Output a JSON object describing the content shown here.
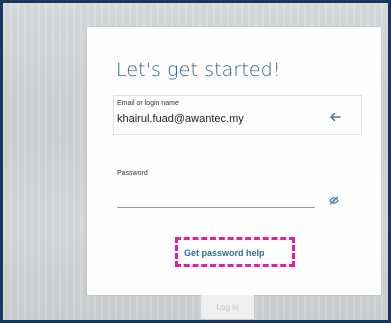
{
  "page": {
    "title": "Let's get started!",
    "email": {
      "label": "Email or login name",
      "value": "khairul.fuad@awantec.my"
    },
    "password": {
      "label": "Password",
      "value": ""
    },
    "help_link": "Get password help",
    "login_button": "Log in",
    "accent_color": "#2f5e86",
    "highlight_color": "#e51ea1"
  }
}
